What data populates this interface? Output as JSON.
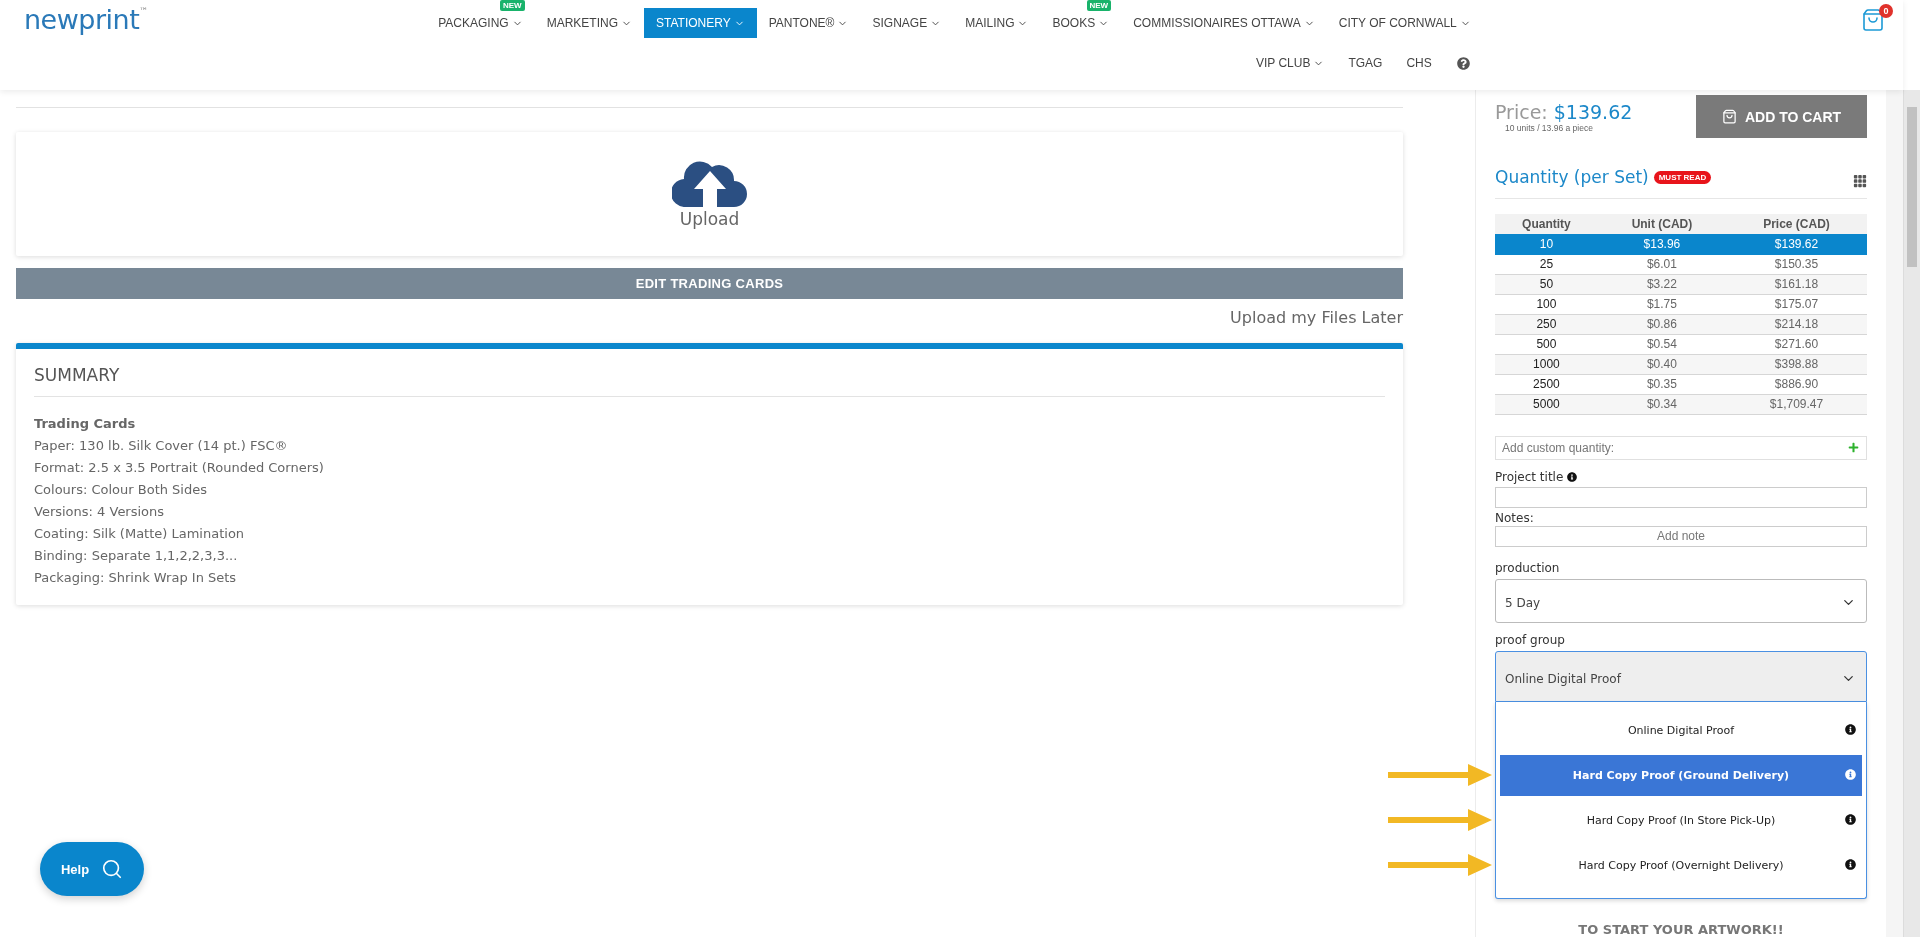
{
  "logo": {
    "text": "newprint",
    "mark": "™"
  },
  "nav": [
    {
      "kind": "menu",
      "label": "PACKAGING",
      "caret": true,
      "badge": "NEW",
      "selected": false
    },
    {
      "kind": "menu",
      "label": "MARKETING",
      "caret": true,
      "selected": false
    },
    {
      "kind": "menu",
      "label": "STATIONERY",
      "caret": true,
      "selected": true
    },
    {
      "kind": "menu",
      "label": "PANTONE®",
      "caret": true,
      "selected": false
    },
    {
      "kind": "menu",
      "label": "SIGNAGE",
      "caret": true,
      "selected": false
    },
    {
      "kind": "menu",
      "label": "MAILING",
      "caret": true,
      "selected": false
    },
    {
      "kind": "menu",
      "label": "BOOKS",
      "caret": true,
      "badge": "NEW",
      "selected": false
    },
    {
      "kind": "menu",
      "label": "COMMISSIONAIRES OTTAWA",
      "caret": true,
      "selected": false
    },
    {
      "kind": "menu",
      "label": "CITY OF CORNWALL",
      "caret": true,
      "selected": false
    },
    {
      "kind": "menu",
      "label": "VIP CLUB",
      "caret": true,
      "selected": false
    },
    {
      "kind": "menu",
      "label": "TGAG",
      "caret": false,
      "selected": false
    },
    {
      "kind": "menu",
      "label": "CHS",
      "caret": false,
      "selected": false
    },
    {
      "kind": "help"
    }
  ],
  "cart": {
    "count": "0"
  },
  "upload": {
    "label": "Upload"
  },
  "edit_button": "EDIT TRADING CARDS",
  "upload_later": "Upload my Files Later",
  "summary": {
    "title": "SUMMARY",
    "product": "Trading Cards",
    "lines": [
      "Paper: 130 lb. Silk Cover (14 pt.) FSC®",
      "Format: 2.5 x 3.5 Portrait (Rounded Corners)",
      "Colours: Colour Both Sides",
      "Versions: 4 Versions",
      "Coating: Silk (Matte) Lamination",
      "Binding: Separate 1,1,2,2,3,3...",
      "Packaging: Shrink Wrap In Sets"
    ]
  },
  "price": {
    "label": "Price:",
    "value": "$139.62",
    "detail": "10 units / 13.96 a piece"
  },
  "add_to_cart": "ADD TO CART",
  "quantity": {
    "title": "Quantity (per Set)",
    "badge": "MUST READ",
    "columns": [
      "Quantity",
      "Unit (CAD)",
      "Price (CAD)"
    ],
    "rows": [
      {
        "cells": [
          "10",
          "$13.96",
          "$139.62"
        ],
        "selected": true
      },
      {
        "cells": [
          "25",
          "$6.01",
          "$150.35"
        ],
        "selected": false
      },
      {
        "cells": [
          "50",
          "$3.22",
          "$161.18"
        ],
        "selected": false
      },
      {
        "cells": [
          "100",
          "$1.75",
          "$175.07"
        ],
        "selected": false
      },
      {
        "cells": [
          "250",
          "$0.86",
          "$214.18"
        ],
        "selected": false
      },
      {
        "cells": [
          "500",
          "$0.54",
          "$271.60"
        ],
        "selected": false
      },
      {
        "cells": [
          "1000",
          "$0.40",
          "$398.88"
        ],
        "selected": false
      },
      {
        "cells": [
          "2500",
          "$0.35",
          "$886.90"
        ],
        "selected": false
      },
      {
        "cells": [
          "5000",
          "$0.34",
          "$1,709.47"
        ],
        "selected": false
      }
    ]
  },
  "custom_quantity": {
    "placeholder": "Add custom quantity:"
  },
  "project_title": {
    "label": "Project title"
  },
  "notes": {
    "label": "Notes:",
    "button": "Add note"
  },
  "production": {
    "label": "production",
    "value": "5 Day"
  },
  "proof_group": {
    "label": "proof group",
    "value": "Online Digital Proof",
    "expanded": true,
    "options": [
      {
        "label": "Online Digital Proof",
        "highlighted": false
      },
      {
        "label": "Hard Copy Proof (Ground Delivery)",
        "highlighted": true
      },
      {
        "label": "Hard Copy Proof (In Store Pick-Up)",
        "highlighted": false
      },
      {
        "label": "Hard Copy Proof (Overnight Delivery)",
        "highlighted": false
      }
    ]
  },
  "download_note": "TO START YOUR ARTWORK!!",
  "help": {
    "label": "Help"
  }
}
